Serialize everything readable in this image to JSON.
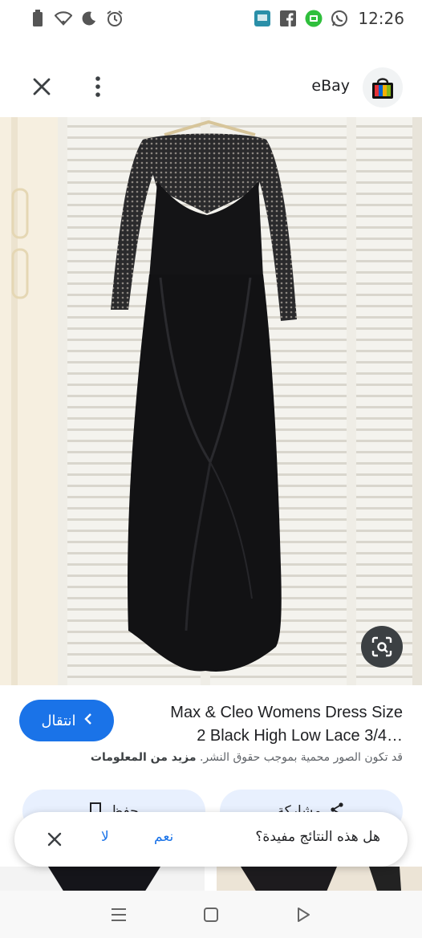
{
  "status_bar": {
    "time": "12:26",
    "left_icons": [
      "battery-icon",
      "wifi-icon",
      "moon-icon",
      "alarm-icon"
    ],
    "right_icons": [
      "app-notification-icon",
      "facebook-icon",
      "messenger-icon",
      "whatsapp-icon"
    ]
  },
  "top_bar": {
    "site_name": "eBay",
    "close_icon": "close-icon",
    "more_icon": "more-vert-icon"
  },
  "result": {
    "title_line1": "Max & Cleo Womens Dress Size",
    "title_line2": "2 Black High Low Lace 3/4…",
    "visit_label": "انتقال",
    "copyright_text": "قد تكون الصور محمية بموجب حقوق النشر.",
    "more_info_label": "مزيد من المعلومات"
  },
  "actions": {
    "save_label": "حفظ",
    "share_label": "مشاركة"
  },
  "feedback": {
    "question": "هل هذه النتائج مفيدة؟",
    "yes_label": "نعم",
    "no_label": "لا"
  },
  "colors": {
    "accent": "#1a73e8",
    "action_bg": "#e8f0fe",
    "dress": "#121214"
  }
}
